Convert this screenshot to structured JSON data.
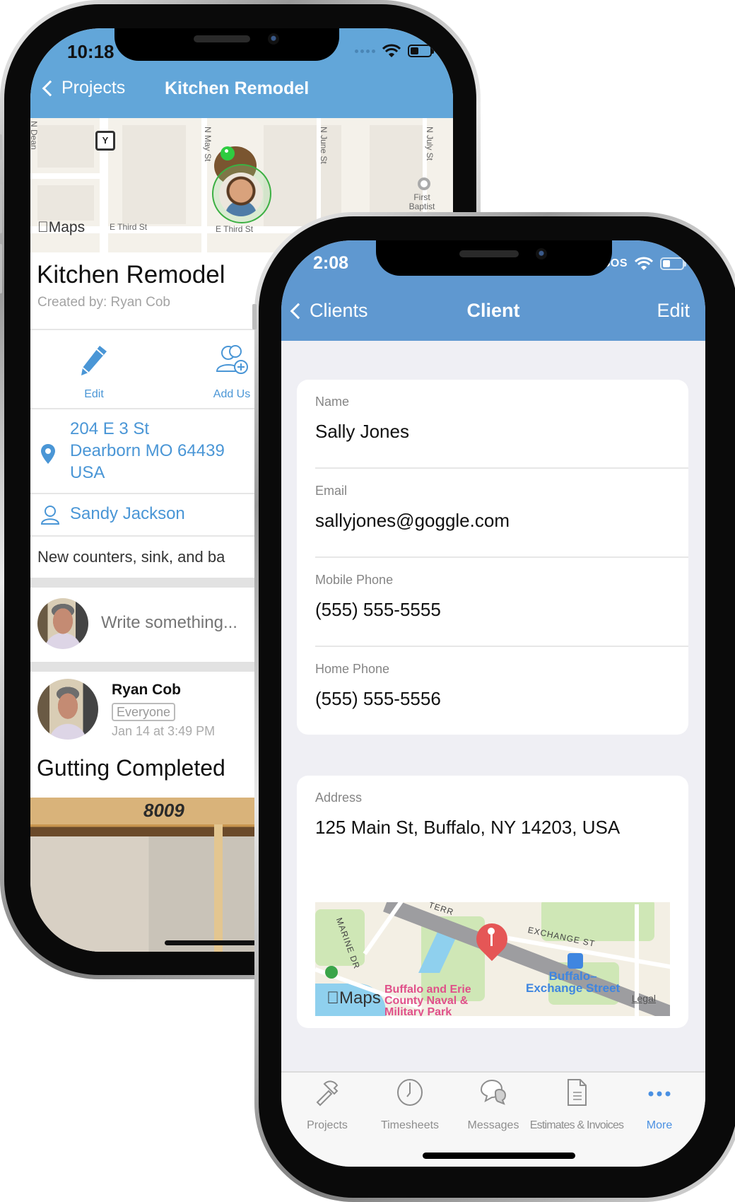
{
  "phone1": {
    "status_bar": {
      "time": "10:18"
    },
    "nav": {
      "back_label": "Projects",
      "title": "Kitchen Remodel"
    },
    "map": {
      "logo_text": "Maps",
      "sign_letter": "Y",
      "street_labels": [
        "E Third St",
        "E Third St",
        "E Third St",
        "N May St",
        "N June St",
        "N July St",
        "N Dean"
      ],
      "poi_label": "First Baptist"
    },
    "project": {
      "title": "Kitchen Remodel",
      "created_by": "Created by: Ryan Cob"
    },
    "actions": [
      {
        "label": "Edit",
        "icon": "pencil-icon"
      },
      {
        "label": "Add Us",
        "icon": "add-users-icon"
      }
    ],
    "address": {
      "line1": "204 E 3 St",
      "line2": "Dearborn MO 64439",
      "line3": "USA"
    },
    "client": "Sandy Jackson",
    "description": "New counters, sink, and ba",
    "compose": {
      "placeholder": "Write something..."
    },
    "post": {
      "author": "Ryan Cob",
      "audience": "Everyone",
      "timestamp": "Jan 14 at 3:49 PM",
      "title": "Gutting Completed",
      "photo_text": "8009"
    }
  },
  "phone2": {
    "status_bar": {
      "time": "2:08",
      "carrier": "SOS"
    },
    "nav": {
      "back_label": "Clients",
      "title": "Client",
      "edit_label": "Edit"
    },
    "fields": [
      {
        "label": "Name",
        "value": "Sally Jones"
      },
      {
        "label": "Email",
        "value": "sallyjones@goggle.com"
      },
      {
        "label": "Mobile Phone",
        "value": "(555) 555-5555"
      },
      {
        "label": "Home Phone",
        "value": "(555) 555-5556"
      }
    ],
    "address": {
      "label": "Address",
      "value": "125 Main St, Buffalo, NY 14203, USA",
      "map": {
        "logo_text": "Maps",
        "legal": "Legal",
        "labels": {
          "street1": "EXCHANGE ST",
          "street2": "MARINE DR",
          "street3": "TERR",
          "station": "Buffalo–\nExchange Street",
          "park": "Buffalo and Erie\nCounty Naval &\nMilitary Park"
        }
      }
    },
    "tabbar": {
      "items": [
        {
          "label": "Projects",
          "icon": "hammer-icon",
          "active": false
        },
        {
          "label": "Timesheets",
          "icon": "clock-icon",
          "active": false
        },
        {
          "label": "Messages",
          "icon": "chat-bubbles-icon",
          "active": false
        },
        {
          "label": "Estimates & Invoices",
          "icon": "document-icon",
          "active": false
        },
        {
          "label": "More",
          "icon": "more-dots-icon",
          "active": true
        }
      ]
    }
  },
  "colors": {
    "nav_blue_phone1": "#62a6d9",
    "nav_blue_phone2": "#5f98d0",
    "link_blue": "#4a96d6",
    "tab_active": "#4a90e2",
    "pin_red": "#e55656",
    "group_bg": "#efeff4"
  }
}
